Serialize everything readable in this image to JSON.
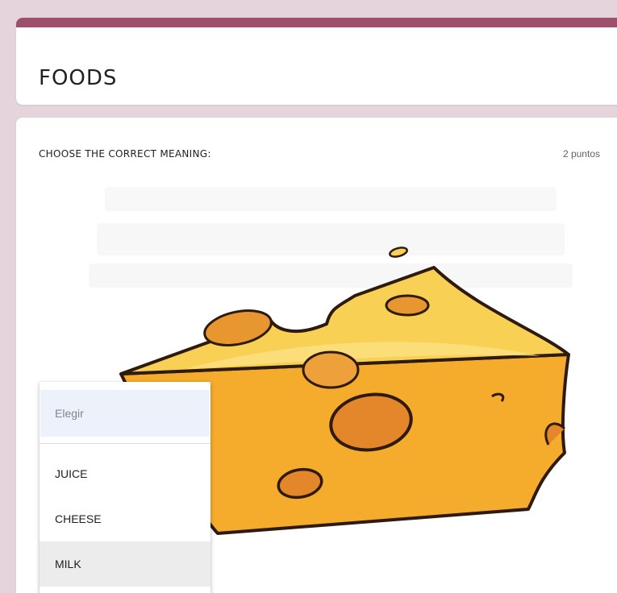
{
  "form": {
    "title": "FOODS",
    "accent_color": "#9e4f6b",
    "background_color": "#e6d4dd"
  },
  "question": {
    "text": "CHOOSE THE CORRECT MEANING:",
    "points": "2 puntos",
    "image": "cheese-wedge-illustration"
  },
  "dropdown": {
    "placeholder": "Elegir",
    "options": [
      "JUICE",
      "CHEESE",
      "MILK"
    ],
    "highlighted_option": "MILK"
  }
}
